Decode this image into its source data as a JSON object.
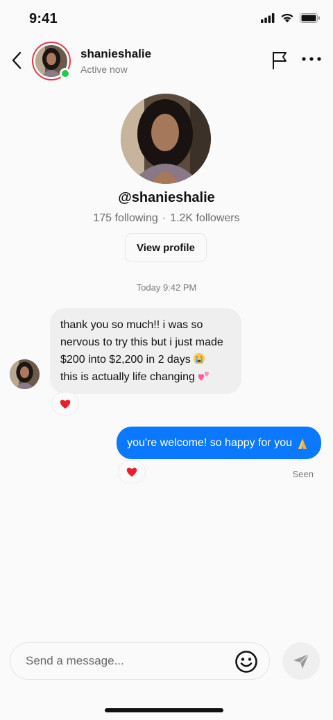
{
  "status_bar": {
    "time": "9:41",
    "icons": [
      "cellular-signal-icon",
      "wifi-icon",
      "battery-icon"
    ]
  },
  "header": {
    "username": "shanieshalie",
    "status": "Active now",
    "avatar_ring_color": "#e03a48",
    "online_color": "#22c94b",
    "icons": [
      "back-chevron-icon",
      "flag-icon",
      "more-icon"
    ]
  },
  "profile": {
    "handle": "@shanieshalie",
    "following": "175 following",
    "separator": "·",
    "followers": "1.2K followers",
    "view_profile_label": "View profile"
  },
  "conversation": {
    "timestamp": "Today 9:42 PM",
    "messages": [
      {
        "direction": "incoming",
        "lines": [
          "thank you so much!! i was so",
          "nervous to try this but i just made",
          "$200 into $2,200 in 2 days",
          "this is actually life changing"
        ],
        "emojis": [
          "crying-face-emoji",
          "two-hearts-emoji"
        ],
        "reaction": "red-heart-emoji",
        "bubble_color": "#efefef"
      },
      {
        "direction": "outgoing",
        "text": "you're welcome! so happy for you",
        "emoji": "folded-hands-emoji",
        "reaction": "red-heart-emoji",
        "bubble_color": "#0a78ff"
      }
    ],
    "seen_label": "Seen"
  },
  "composer": {
    "placeholder": "Send a message...",
    "icons": [
      "emoji-smiley-icon",
      "send-icon"
    ]
  }
}
